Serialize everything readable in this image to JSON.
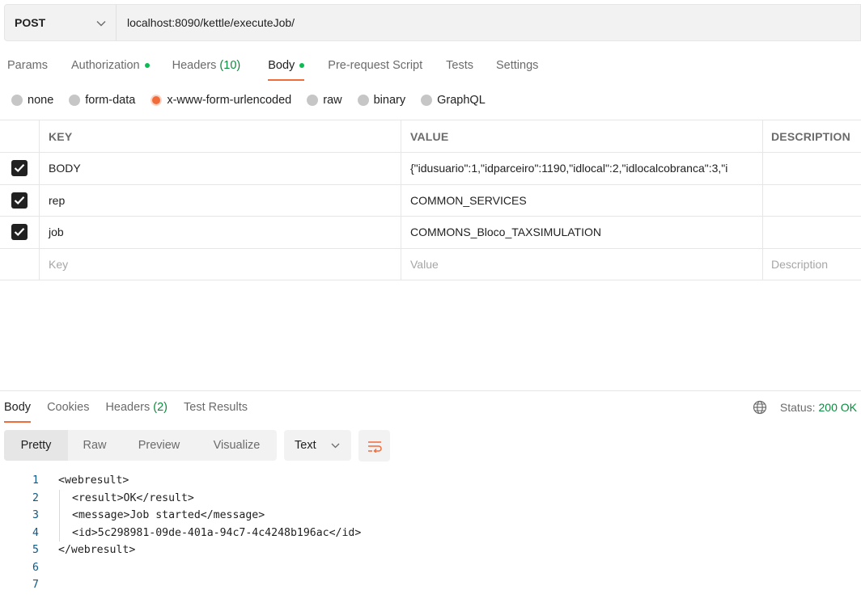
{
  "request": {
    "method": "POST",
    "url": "localhost:8090/kettle/executeJob/"
  },
  "request_tabs": [
    {
      "label": "Params",
      "dot": false,
      "count": ""
    },
    {
      "label": "Authorization",
      "dot": true,
      "count": ""
    },
    {
      "label": "Headers",
      "dot": false,
      "count": "(10)"
    },
    {
      "label": "Body",
      "dot": true,
      "count": "",
      "active": true
    },
    {
      "label": "Pre-request Script",
      "dot": false,
      "count": ""
    },
    {
      "label": "Tests",
      "dot": false,
      "count": ""
    },
    {
      "label": "Settings",
      "dot": false,
      "count": ""
    }
  ],
  "body_types": [
    {
      "label": "none",
      "checked": false
    },
    {
      "label": "form-data",
      "checked": false
    },
    {
      "label": "x-www-form-urlencoded",
      "checked": true
    },
    {
      "label": "raw",
      "checked": false
    },
    {
      "label": "binary",
      "checked": false
    },
    {
      "label": "GraphQL",
      "checked": false
    }
  ],
  "table": {
    "headers": {
      "key": "KEY",
      "value": "VALUE",
      "description": "DESCRIPTION"
    },
    "rows": [
      {
        "checked": true,
        "key": "BODY",
        "value": "{\"idusuario\":1,\"idparceiro\":1190,\"idlocal\":2,\"idlocalcobranca\":3,\"i",
        "description": ""
      },
      {
        "checked": true,
        "key": "rep",
        "value": "COMMON_SERVICES",
        "description": ""
      },
      {
        "checked": true,
        "key": "job",
        "value": "COMMONS_Bloco_TAXSIMULATION",
        "description": ""
      }
    ],
    "placeholders": {
      "key": "Key",
      "value": "Value",
      "description": "Description"
    }
  },
  "response": {
    "tabs": [
      {
        "label": "Body",
        "count": "",
        "active": true
      },
      {
        "label": "Cookies",
        "count": ""
      },
      {
        "label": "Headers",
        "count": "(2)"
      },
      {
        "label": "Test Results",
        "count": ""
      }
    ],
    "status_label": "Status:",
    "status_value": "200 OK",
    "views": [
      "Pretty",
      "Raw",
      "Preview",
      "Visualize"
    ],
    "active_view": "Pretty",
    "format": "Text",
    "code_lines": [
      {
        "n": "1",
        "text": "<webresult>",
        "indent": false
      },
      {
        "n": "2",
        "text": "<result>OK</result>",
        "indent": true
      },
      {
        "n": "3",
        "text": "<message>Job started</message>",
        "indent": true
      },
      {
        "n": "4",
        "text": "<id>5c298981-09de-401a-94c7-4c4248b196ac</id>",
        "indent": true
      },
      {
        "n": "5",
        "text": "</webresult>",
        "indent": false
      },
      {
        "n": "6",
        "text": "",
        "indent": false
      },
      {
        "n": "7",
        "text": "",
        "indent": false
      }
    ]
  },
  "colors": {
    "accent": "#f26b3a",
    "dot_green": "#0cbb52",
    "status_green": "#0c8a3f"
  },
  "icons": {
    "method_dropdown": "chevron-down-icon",
    "checkbox": "checkmark-icon",
    "globe": "globe-icon",
    "format_dropdown": "chevron-down-icon",
    "wrap": "wrap-lines-icon"
  }
}
